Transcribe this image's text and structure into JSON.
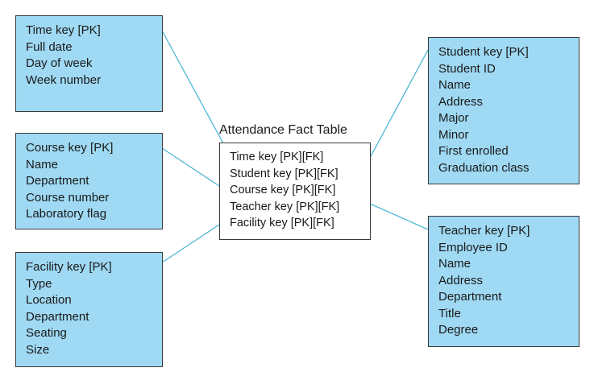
{
  "fact_table": {
    "title": "Attendance Fact Table",
    "fields": [
      "Time key [PK][FK]",
      "Student key [PK][FK]",
      "Course key [PK][FK]",
      "Teacher key [PK][FK]",
      "Facility key [PK][FK]"
    ]
  },
  "dimensions": {
    "time": {
      "fields": [
        "Time key [PK]",
        "Full date",
        "Day of week",
        "Week number"
      ]
    },
    "course": {
      "fields": [
        "Course key [PK]",
        "Name",
        "Department",
        "Course number",
        "Laboratory flag"
      ]
    },
    "facility": {
      "fields": [
        "Facility key [PK]",
        "Type",
        "Location",
        "Department",
        "Seating",
        "Size"
      ]
    },
    "student": {
      "fields": [
        "Student key [PK]",
        "Student ID",
        "Name",
        "Address",
        "Major",
        "Minor",
        "First enrolled",
        "Graduation class"
      ]
    },
    "teacher": {
      "fields": [
        "Teacher key [PK]",
        "Employee ID",
        "Name",
        "Address",
        "Department",
        "Title",
        "Degree"
      ]
    }
  },
  "colors": {
    "dimension_fill": "#9fd9f3",
    "connector": "#4ab7d6",
    "border": "#3a3a3a"
  }
}
